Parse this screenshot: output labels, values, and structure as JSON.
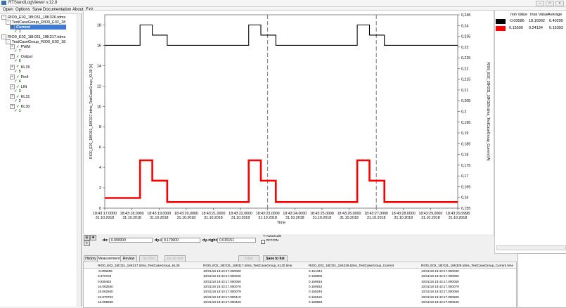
{
  "window": {
    "title": "RTStandLogViewer v.12.8"
  },
  "menu": [
    "Open",
    "Options",
    "Save",
    "Documentation",
    "About",
    "Exit"
  ],
  "tree": [
    {
      "text": "RIO0_E02_18l:031_18K326.tdms",
      "level": 0,
      "exp": "-",
      "chk": false,
      "sel": false
    },
    {
      "text": "TestCaseGroup_RIO0_E02_18",
      "level": 1,
      "exp": "-",
      "chk": false,
      "sel": false
    },
    {
      "text": "Current",
      "level": 2,
      "exp": "+",
      "chk": false,
      "sel": true
    },
    {
      "text": "1",
      "level": 3,
      "exp": "",
      "chk": true,
      "sel": false
    },
    {
      "text": "RIO0_E02_18l:031_18K317.tdms",
      "level": 0,
      "exp": "-",
      "chk": false,
      "sel": false
    },
    {
      "text": "TestCaseGroup_RIO0_E02_18",
      "level": 1,
      "exp": "-",
      "chk": false,
      "sel": false
    },
    {
      "text": "PWM",
      "level": 2,
      "exp": "+",
      "chk": true,
      "sel": false
    },
    {
      "text": "7",
      "level": 3,
      "exp": "",
      "chk": true,
      "sel": false
    },
    {
      "text": "Output",
      "level": 2,
      "exp": "+",
      "chk": true,
      "sel": false
    },
    {
      "text": "6",
      "level": 3,
      "exp": "",
      "chk": true,
      "sel": false
    },
    {
      "text": "KL15",
      "level": 2,
      "exp": "+",
      "chk": true,
      "sel": false
    },
    {
      "text": "5",
      "level": 3,
      "exp": "",
      "chk": true,
      "sel": false
    },
    {
      "text": "Pin4",
      "level": 2,
      "exp": "+",
      "chk": true,
      "sel": false
    },
    {
      "text": "4",
      "level": 3,
      "exp": "",
      "chk": true,
      "sel": false
    },
    {
      "text": "LIN",
      "level": 2,
      "exp": "+",
      "chk": true,
      "sel": false
    },
    {
      "text": "3",
      "level": 3,
      "exp": "",
      "chk": true,
      "sel": false
    },
    {
      "text": "KL31",
      "level": 2,
      "exp": "+",
      "chk": true,
      "sel": false
    },
    {
      "text": "2",
      "level": 3,
      "exp": "",
      "chk": true,
      "sel": false
    },
    {
      "text": "KL30",
      "level": 2,
      "exp": "+",
      "chk": true,
      "sel": false
    },
    {
      "text": "1",
      "level": 3,
      "exp": "",
      "chk": true,
      "sel": false
    }
  ],
  "chart_data": {
    "type": "line",
    "xlabel": "Time",
    "ylabel_left": "RIO0_E02_18K031_18K317.tdms_TestCaseGroup_KL30 [V]",
    "ylabel_right": "RIO0_E02_18K031_18K326.tdms_TestCaseGroup_Current [A]",
    "y_left": {
      "min": 0,
      "max": 19,
      "ticks": [
        0,
        2,
        4,
        6,
        8,
        10,
        12,
        14,
        16,
        18
      ]
    },
    "y_right": {
      "min": 0.155,
      "max": 0.245,
      "ticks": [
        "0,245",
        "0,24",
        "0,235",
        "0,23",
        "0,225",
        "0,22",
        "0,215",
        "0,21",
        "0,205",
        "0,2",
        "0,195",
        "0,19",
        "0,185",
        "0,18",
        "0,175",
        "0,17",
        "0,165",
        "0,16",
        "0,155"
      ]
    },
    "x_ticks": [
      {
        "time": "18:43:17,0000",
        "date": "31.10.2018"
      },
      {
        "time": "18:43:18,0000",
        "date": "31.10.2018"
      },
      {
        "time": "18:43:19,0000",
        "date": "31.10.2018"
      },
      {
        "time": "18:43:20,0000",
        "date": "31.10.2018"
      },
      {
        "time": "18:43:21,0000",
        "date": "31.10.2018"
      },
      {
        "time": "18:43:22,0000",
        "date": "31.10.2018"
      },
      {
        "time": "18:43:23,0000",
        "date": "31.10.2018"
      },
      {
        "time": "18:43:24,0000",
        "date": "31.10.2018"
      },
      {
        "time": "18:43:25,0000",
        "date": "31.10.2018"
      },
      {
        "time": "18:43:26,0000",
        "date": "31.10.2018"
      },
      {
        "time": "18:43:27,0000",
        "date": "31.10.2018"
      },
      {
        "time": "18:43:28,0000",
        "date": "31.10.2018"
      },
      {
        "time": "18:43:29,0000",
        "date": "31.10.2018"
      },
      {
        "time": "18:43:29,9998",
        "date": "31.10.2018"
      }
    ],
    "x_range": [
      17.0,
      29.9998
    ],
    "cursors_x": [
      23.0,
      27.0
    ],
    "series": [
      {
        "color": "#000000",
        "axis": "left",
        "x": [
          17.0,
          18.3,
          18.3,
          18.75,
          18.75,
          19.3,
          19.3,
          22.3,
          22.3,
          22.75,
          22.75,
          23.3,
          23.3,
          26.3,
          26.3,
          26.75,
          26.75,
          27.3,
          27.3,
          29.9998
        ],
        "y": [
          16.0,
          16.0,
          18.0,
          18.0,
          17.0,
          17.0,
          16.0,
          16.0,
          18.0,
          18.0,
          17.0,
          17.0,
          16.0,
          16.0,
          18.0,
          18.0,
          17.0,
          17.0,
          16.0,
          16.0
        ]
      },
      {
        "color": "#ff0000",
        "axis": "left",
        "x": [
          17.0,
          18.3,
          18.3,
          18.75,
          18.75,
          19.3,
          19.3,
          22.3,
          22.3,
          22.75,
          22.75,
          23.3,
          23.3,
          26.3,
          26.3,
          26.75,
          26.75,
          27.3,
          27.3,
          29.9998
        ],
        "y": [
          1.0,
          1.0,
          4.7,
          4.7,
          2.7,
          2.7,
          0.6,
          0.6,
          4.7,
          4.7,
          2.7,
          2.7,
          0.6,
          0.6,
          4.7,
          4.7,
          2.7,
          2.7,
          0.6,
          0.6
        ]
      }
    ]
  },
  "legend": {
    "headers": [
      "min Value",
      "max Value",
      "Average"
    ],
    "rows": [
      {
        "color": "#000000",
        "min": "-0.00586",
        "max": "18.16992",
        "avg": "6.40295"
      },
      {
        "color": "#ff0000",
        "min": "0.15590",
        "max": "0.24134",
        "avg": "0.15393"
      }
    ]
  },
  "cursor_tools": {
    "dx_label": "dx:",
    "dx_value": "0.000000",
    "dy_left_label": "dy-left:",
    "dy_left_value": "0.170000",
    "dy_right_label": "dy-right:",
    "dy_right_value": "0.015151",
    "autoscale_label": "Y-AutoScale",
    "off_on_label": "OFF/ON"
  },
  "tabs": [
    "History",
    "Measurement",
    "Review"
  ],
  "toolbar_buttons": [
    "Go Plot",
    "Go to next",
    "Filter",
    "Save to list"
  ],
  "table": {
    "headers": [
      "RIO0_E02_18l:031_18K317.tdms_TestCaseGroup_KL30",
      "RIO0_E02_18l:031_18K317.tdms_TestCaseGroup_KL30 time",
      "RIO0_E02_18l:031_18K326.tdms_TestCaseGroup_Current",
      "RIO0_E02_18l:031_18K326.tdms_TestCaseGroup_Current time"
    ],
    "rows": [
      [
        "-0.005859",
        "10/31/18 18:43:17.000000",
        "0.161344",
        "10/31/18 18:43:17.000030"
      ],
      [
        "0.970703",
        "10/31/18 18:43:17.000020",
        "0.159505",
        "10/31/18 18:43:17.000050"
      ],
      [
        "0.939453",
        "10/31/18 18:43:17.000050",
        "0.159915",
        "10/31/18 18:43:17.000059"
      ],
      [
        "16.062500",
        "10/31/18 18:43:17.000070",
        "0.160932",
        "10/31/18 18:43:17.000079"
      ],
      [
        "16.062500",
        "10/31/18 18:43:17.000079",
        "0.159249",
        "10/31/18 18:43:17.000059"
      ],
      [
        "15.970703",
        "10/31/18 18:43:17.000410",
        "0.160110",
        "10/31/18 18:43:17.000609"
      ],
      [
        "16.005859",
        "10/31/18 18:43:17.000429",
        "0.159588",
        "10/31/18 18:43:17.000649"
      ]
    ]
  }
}
